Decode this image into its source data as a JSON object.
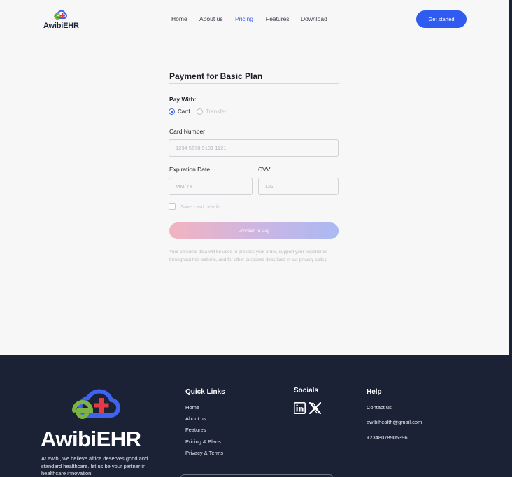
{
  "header": {
    "logo_text": "AwibiEHR",
    "nav": [
      {
        "label": "Home",
        "active": false
      },
      {
        "label": "About us",
        "active": false
      },
      {
        "label": "Pricing",
        "active": true
      },
      {
        "label": "Features",
        "active": false
      },
      {
        "label": "Download",
        "active": false
      }
    ],
    "cta_label": "Get started"
  },
  "form": {
    "title": "Payment for Basic Plan",
    "pay_with_label": "Pay With:",
    "options": [
      {
        "label": "Card",
        "selected": true
      },
      {
        "label": "Transfer",
        "selected": false
      }
    ],
    "card_number": {
      "label": "Card Number",
      "placeholder": "1234  5678  9101  1121",
      "value": ""
    },
    "expiration": {
      "label": "Expiration Date",
      "placeholder": "MM/YY",
      "value": ""
    },
    "cvv": {
      "label": "CVV",
      "placeholder": "123",
      "value": ""
    },
    "save_card_label": "Save card details",
    "save_card_checked": false,
    "submit_label": "Proceed to Pay",
    "privacy_text": "Your personal data will be used to process your order, support your experience throughout this website, and for other purposes described in our privacy policy."
  },
  "footer": {
    "logo_text": "AwibiEHR",
    "description": "At awibi, we believe africa deserves good and standard healthcare. let us be your partner in healthcare innovation!",
    "quick_links": {
      "title": "Quick Links",
      "items": [
        "Home",
        "About us",
        "Features",
        "Pricing & Plans",
        "Privacy & Terms"
      ]
    },
    "socials": {
      "title": "Socials",
      "icons": [
        "linkedin-icon",
        "x-icon"
      ]
    },
    "help": {
      "title": "Help",
      "contact_label": "Contact us",
      "email": "awibihealth@gmail.com",
      "phone": "+2348078905396"
    }
  },
  "colors": {
    "accent": "#2f5bf0",
    "footer_bg": "#1b2236",
    "logo_green": "#7cb342",
    "logo_blue": "#3d63f0",
    "logo_red": "#e53945"
  }
}
